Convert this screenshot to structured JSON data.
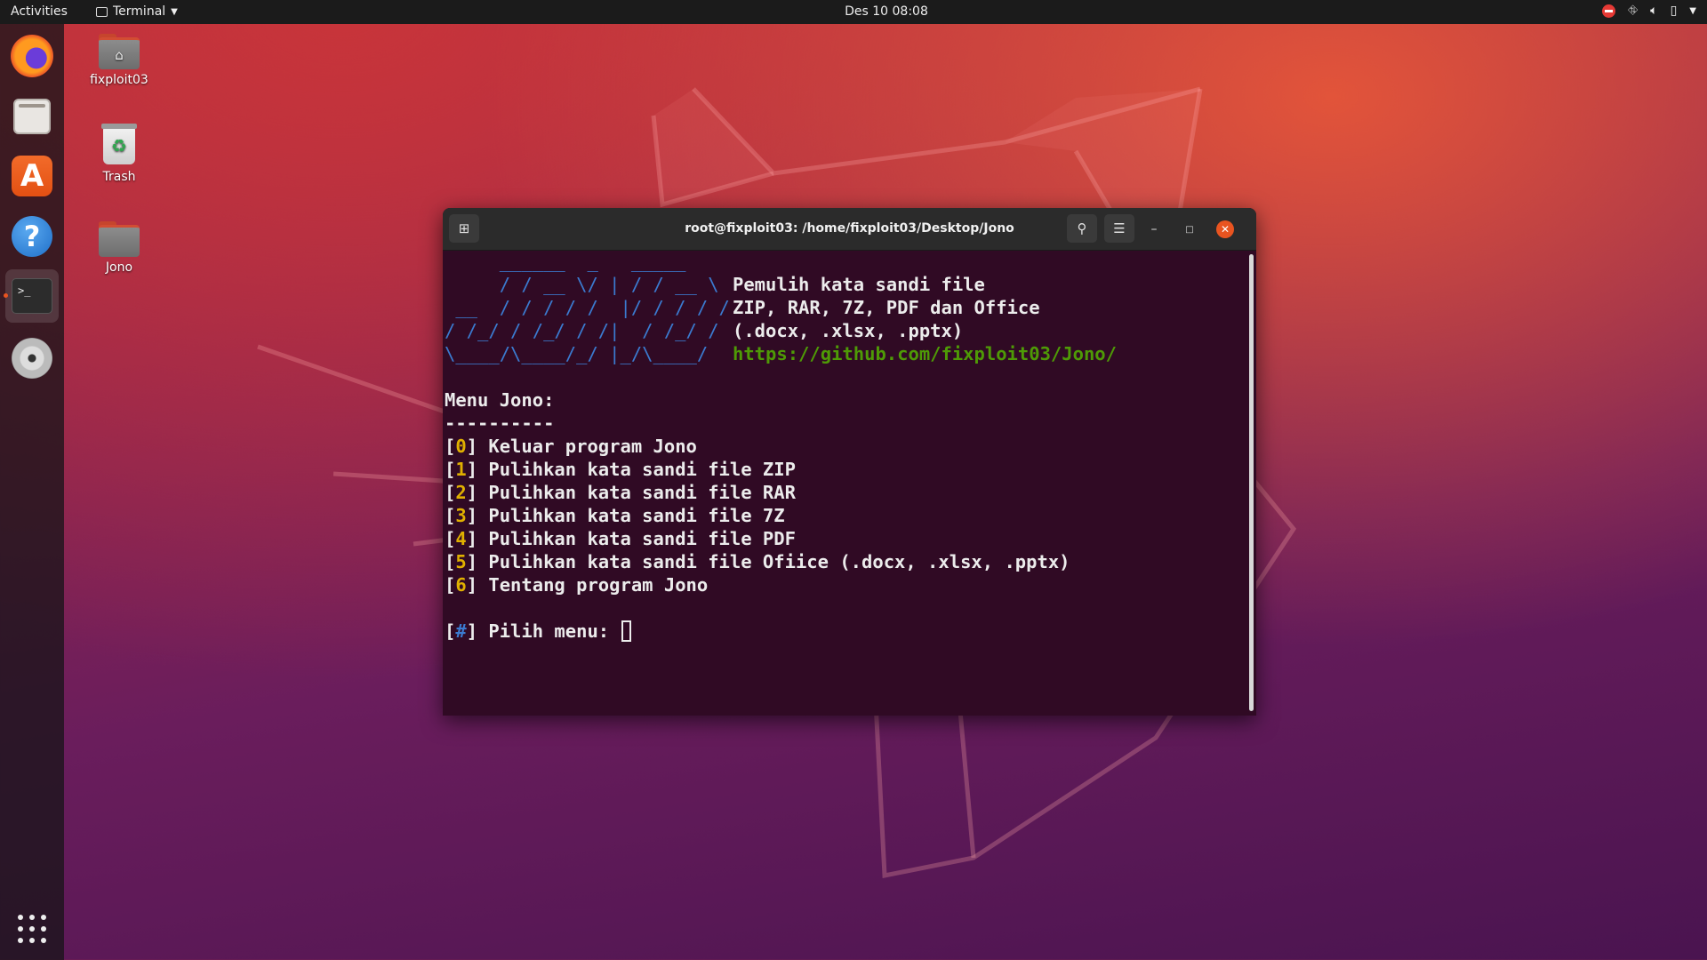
{
  "topbar": {
    "activities": "Activities",
    "app_name": "Terminal",
    "clock": "Des 10  08:08"
  },
  "dock": {
    "items": [
      "firefox-icon",
      "files-icon",
      "software-store-icon",
      "help-icon",
      "terminal-icon",
      "disc-icon",
      "show-apps-icon"
    ]
  },
  "desktop": {
    "icons": [
      {
        "label": "fixploit03"
      },
      {
        "label": "Trash"
      },
      {
        "label": "Jono"
      }
    ]
  },
  "terminal": {
    "title": "root@fixploit03: /home/fixploit03/Desktop/Jono",
    "logo_lines": [
      "     ______  _   _____ ",
      "     / / __ \\/ | / / __ \\",
      " __  / / / / /  |/ / / / /",
      "/ /_/ / /_/ / /|  / /_/ / ",
      "\\____/\\____/_/ |_/\\____/  "
    ],
    "info_lines": [
      "Pemulih kata sandi file",
      "ZIP, RAR, 7Z, PDF dan Office",
      "(.docx, .xlsx, .pptx)"
    ],
    "link": "https://github.com/fixploit03/Jono/",
    "menu_title": "Menu Jono:",
    "menu_rule": "----------",
    "menu_items": [
      {
        "num": "0",
        "text": "Keluar program Jono"
      },
      {
        "num": "1",
        "text": "Pulihkan kata sandi file ZIP"
      },
      {
        "num": "2",
        "text": "Pulihkan kata sandi file RAR"
      },
      {
        "num": "3",
        "text": "Pulihkan kata sandi file 7Z"
      },
      {
        "num": "4",
        "text": "Pulihkan kata sandi file PDF"
      },
      {
        "num": "5",
        "text": "Pulihkan kata sandi file Ofiice (.docx, .xlsx, .pptx)"
      },
      {
        "num": "6",
        "text": "Tentang program Jono"
      }
    ],
    "prompt_symbol": "#",
    "prompt_text": "Pilih menu:",
    "input_value": ""
  },
  "colors": {
    "terminal_bg": "#300a24",
    "accent": "#e95420",
    "logo": "#3b7bd0",
    "link": "#4e9a06",
    "menu_number": "#e0b000"
  }
}
